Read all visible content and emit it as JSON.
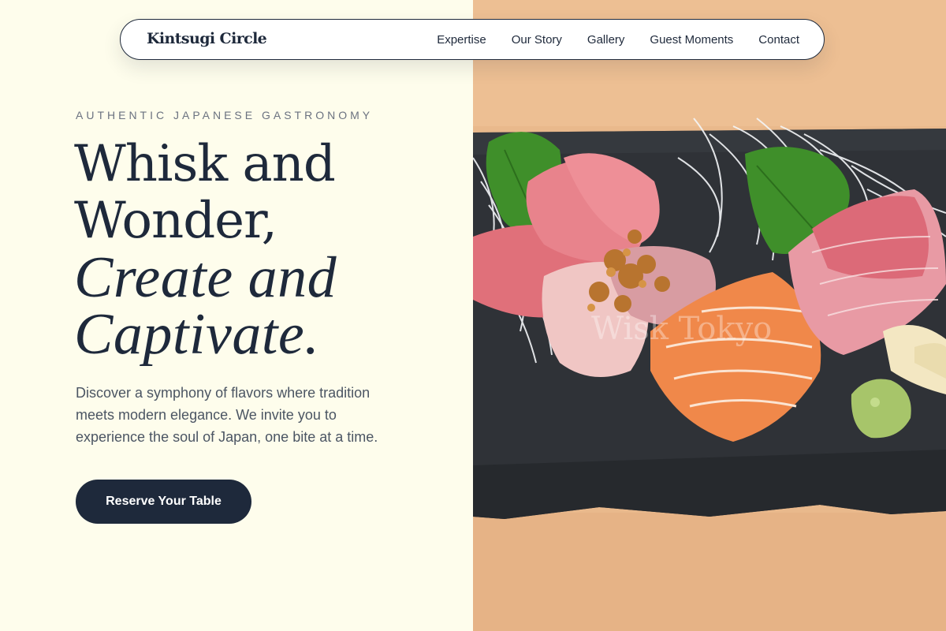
{
  "nav": {
    "brand": "Kintsugi Circle",
    "links": [
      {
        "label": "Expertise"
      },
      {
        "label": "Our Story"
      },
      {
        "label": "Gallery"
      },
      {
        "label": "Guest Moments"
      },
      {
        "label": "Contact"
      }
    ]
  },
  "hero": {
    "eyebrow": "AUTHENTIC JAPANESE GASTRONOMY",
    "headline_line1": "Whisk and",
    "headline_line2": "Wonder,",
    "headline_line3": "Create and",
    "headline_line4": "Captivate.",
    "description": "Discover a symphony of flavors where tradition meets modern elegance. We invite you to experience the soul of Japan, one bite at a time.",
    "cta_label": "Reserve Your Table"
  },
  "image": {
    "alt": "sashimi-platter-photo",
    "watermark": "Wisk Tokyo"
  },
  "colors": {
    "background": "#fefdec",
    "navy": "#1e293b",
    "muted": "#6b7280",
    "wood": "#e9b98c"
  }
}
